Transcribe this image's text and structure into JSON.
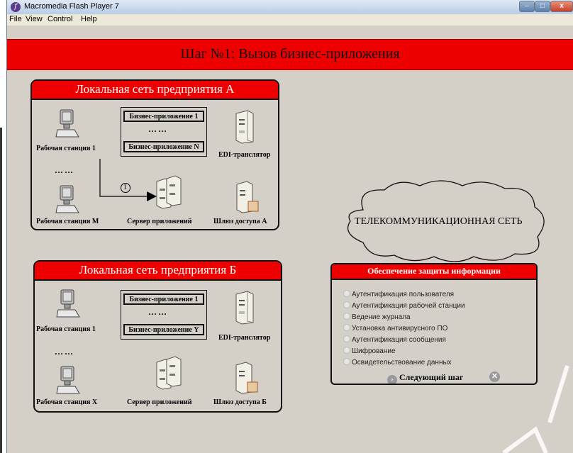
{
  "window": {
    "title": "Macromedia Flash Player 7",
    "icon_letter": "f",
    "min": "–",
    "max": "□",
    "close": "x"
  },
  "menu": [
    "File",
    "View",
    "Control",
    "Help"
  ],
  "banner": {
    "title": "Шаг №1: Вызов бизнес-приложения"
  },
  "panel_a": {
    "title": "Локальная сеть предприятия А",
    "ws1": "Рабочая станция  1",
    "dots": "……",
    "wsm": "Рабочая станция М",
    "app1": "Бизнес-приложение 1",
    "app_dots": "……",
    "appn": "Бизнес-приложение N",
    "edi": "EDI-транслятор",
    "server": "Сервер приложений",
    "gateway": "Шлюз доступа А",
    "step_marker": "1"
  },
  "panel_b": {
    "title": "Локальная сеть предприятия Б",
    "ws1": "Рабочая станция  1",
    "dots": "……",
    "wsx": "Рабочая станция Х",
    "app1": "Бизнес-приложение 1",
    "app_dots": "……",
    "appy": "Бизнес-приложение Y",
    "edi": "EDI-транслятор",
    "server": "Сервер приложений",
    "gateway": "Шлюз доступа Б"
  },
  "cloud": {
    "label": "ТЕЛЕКОММУНИКАЦИОННАЯ СЕТЬ"
  },
  "security": {
    "title": "Обеспечение защиты информации",
    "options": [
      "Аутентификация пользователя",
      "Аутентификация рабочей станции",
      "Ведение журнала",
      "Установка антивирусного ПО",
      "Аутентификация сообщения",
      "Шифрование",
      "Освидетельствование данных"
    ],
    "next": "Следующий шаг",
    "next_icon": "›",
    "close_icon": "✕"
  }
}
